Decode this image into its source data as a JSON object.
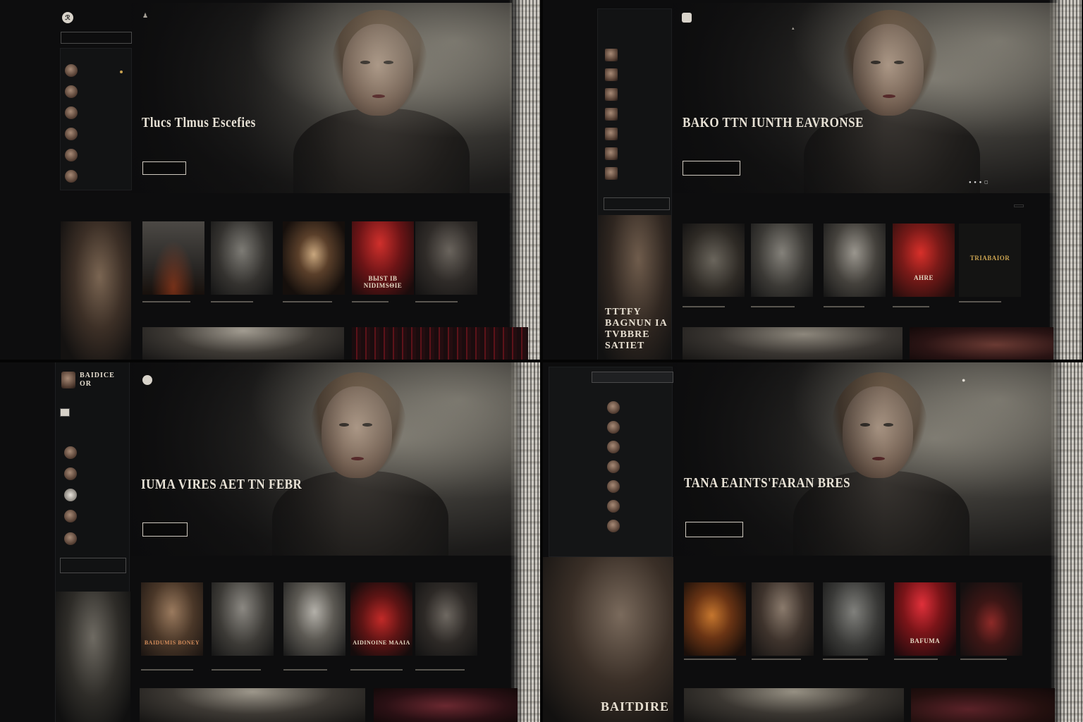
{
  "panels": [
    {
      "nav": [
        "",
        "",
        ""
      ],
      "logo": "ℛ",
      "search": "",
      "hero": {
        "kicker": "",
        "title": "Tlucs Tlmus Escefies",
        "desc": "",
        "button": ""
      },
      "sidebar_items": [
        "",
        "",
        "",
        "",
        "",
        ""
      ],
      "section": "",
      "cards": [
        {
          "title": "",
          "caption": ""
        },
        {
          "title": "",
          "caption": ""
        },
        {
          "title": "",
          "caption": ""
        },
        {
          "title": "BЫST IB NIDIMSΘIE",
          "caption": ""
        },
        {
          "title": "",
          "caption": ""
        }
      ]
    },
    {
      "nav": [
        ""
      ],
      "logo": "",
      "search": "",
      "hero": {
        "kicker": "",
        "title": "BAKO TTN IUNTH EAVRONSE",
        "desc": "",
        "button": ""
      },
      "sidebar_items": [
        "",
        "",
        "",
        "",
        "",
        "",
        ""
      ],
      "section": "",
      "sidebar_poster": "TTTFY BAGNUN IA TVBBRE SATIET",
      "cards": [
        {
          "title": "",
          "caption": ""
        },
        {
          "title": "",
          "caption": ""
        },
        {
          "title": "",
          "caption": ""
        },
        {
          "title": "AHRE",
          "caption": ""
        },
        {
          "title": "TRIABAIOR",
          "caption": ""
        }
      ]
    },
    {
      "nav": [
        "",
        "",
        "",
        "",
        "",
        "",
        "",
        "",
        "",
        "",
        ""
      ],
      "logo": "",
      "brand": "BAIDICE OR",
      "hero": {
        "kicker": "",
        "title": "IUMA VIRES AET TN FEBR",
        "desc": "",
        "button": ""
      },
      "sidebar_items": [
        "",
        "",
        "",
        "",
        "",
        ""
      ],
      "section": "",
      "cards": [
        {
          "title": "BAIDUMIS BONEY",
          "caption": ""
        },
        {
          "title": "",
          "caption": ""
        },
        {
          "title": "",
          "caption": ""
        },
        {
          "title": "AIDINOINE MAAIA",
          "caption": ""
        },
        {
          "title": "",
          "caption": ""
        }
      ]
    },
    {
      "nav": [
        "",
        "",
        "",
        "",
        ""
      ],
      "hero": {
        "kicker": "",
        "title": "TANA EAINTS'FARAN BRES",
        "desc": "",
        "button": ""
      },
      "sidebar_items": [
        "",
        "",
        "",
        "",
        "",
        "",
        ""
      ],
      "section": "",
      "poster_text": "BAITDIRE",
      "cards": [
        {
          "title": "",
          "caption": ""
        },
        {
          "title": "",
          "caption": ""
        },
        {
          "title": "",
          "caption": ""
        },
        {
          "title": "BAFUMA",
          "caption": ""
        },
        {
          "title": "",
          "caption": ""
        }
      ]
    }
  ],
  "colors": {
    "accent_red": "#b8282c",
    "gold": "#c9a250",
    "paper": "#e9e5dc"
  }
}
